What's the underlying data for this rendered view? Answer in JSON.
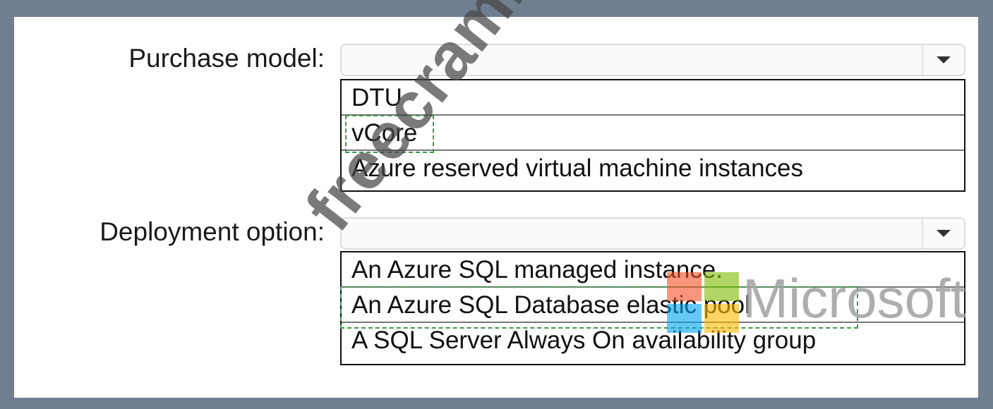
{
  "purchase_model": {
    "label": "Purchase model:",
    "options": [
      "DTU",
      "vCore",
      "Azure reserved virtual machine instances"
    ],
    "selected": "vCore"
  },
  "deployment_option": {
    "label": "Deployment option:",
    "options": [
      "An Azure SQL managed instance.",
      "An Azure SQL Database elastic pool",
      "A SQL Server Always On availability group"
    ],
    "selected": "An Azure SQL Database elastic pool"
  },
  "watermarks": {
    "site": "freecram.net",
    "brand": "Microsoft"
  },
  "icons": {
    "dropdown": "chevron-down-icon",
    "brand_logo": "microsoft-logo-icon"
  },
  "colors": {
    "frame": "#6f7f8f",
    "selection_dash": "#3d9a4a",
    "logo_red": "#f25022",
    "logo_green": "#7fba00",
    "logo_blue": "#00a4ef",
    "logo_yellow": "#ffb900"
  }
}
